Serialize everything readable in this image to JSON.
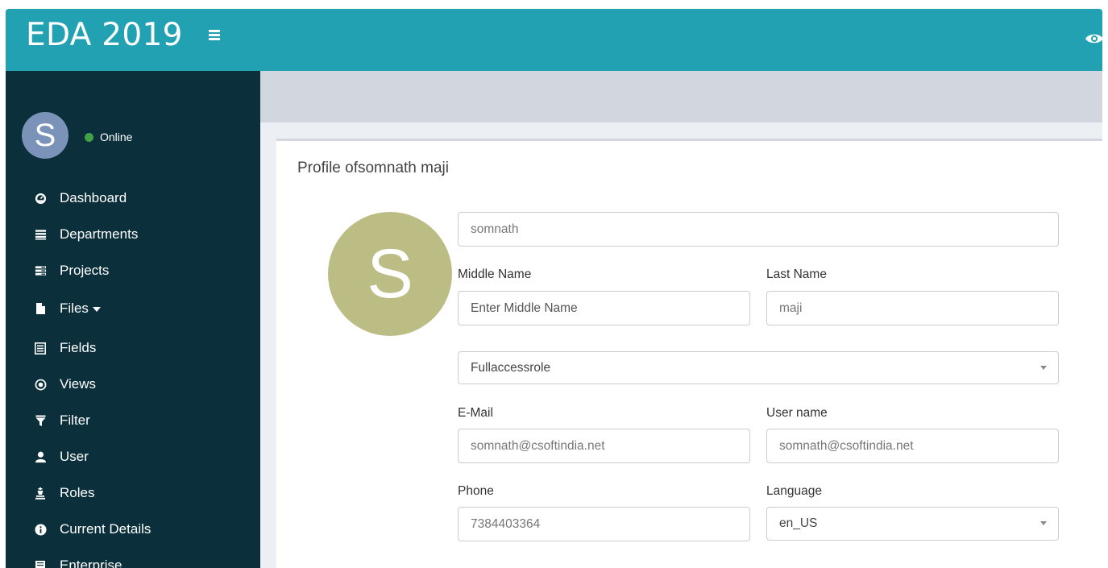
{
  "header": {
    "brand": "EDA 2019",
    "menu_icon": "hamburger-icon",
    "right_icon": "eye-icon",
    "colors": {
      "header_bg": "#22a1b2",
      "sidebar_bg": "#0b2f3b"
    }
  },
  "sidebar": {
    "user_initial": "S",
    "status": "Online",
    "status_color": "#43a047",
    "items": [
      {
        "label": "Dashboard",
        "icon": "dashboard-icon"
      },
      {
        "label": "Departments",
        "icon": "list-icon"
      },
      {
        "label": "Projects",
        "icon": "tasks-icon"
      },
      {
        "label": "Files",
        "icon": "file-icon"
      },
      {
        "label": "Fields",
        "icon": "list-alt-icon"
      },
      {
        "label": "Views",
        "icon": "record-icon"
      },
      {
        "label": "Filter",
        "icon": "filter-icon"
      },
      {
        "label": "User",
        "icon": "user-icon"
      },
      {
        "label": "Roles",
        "icon": "roles-icon"
      },
      {
        "label": "Current Details",
        "icon": "info-icon"
      },
      {
        "label": "Enterprise",
        "icon": "enterprise-icon"
      }
    ]
  },
  "profile": {
    "title": "Profile ofsomnath maji",
    "avatar_initial": "S",
    "avatar_color": "#bcbd84",
    "first_name": {
      "value": "somnath"
    },
    "middle_name": {
      "label": "Middle Name",
      "placeholder": "Enter Middle Name",
      "value": ""
    },
    "last_name": {
      "label": "Last Name",
      "value": "maji"
    },
    "role": {
      "value": "Fullaccessrole"
    },
    "email": {
      "label": "E-Mail",
      "value": "somnath@csoftindia.net"
    },
    "username": {
      "label": "User name",
      "value": "somnath@csoftindia.net"
    },
    "phone": {
      "label": "Phone",
      "value": "7384403364"
    },
    "language": {
      "label": "Language",
      "value": "en_US"
    }
  }
}
